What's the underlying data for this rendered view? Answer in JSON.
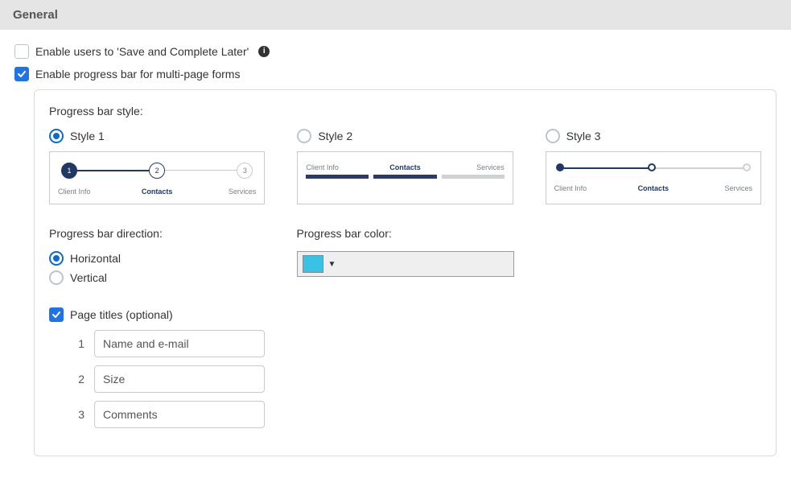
{
  "panel": {
    "title": "General"
  },
  "options": {
    "save_later": {
      "label": "Enable users to 'Save and Complete Later'",
      "checked": false,
      "info_icon": "info-icon"
    },
    "progress_bar": {
      "label": "Enable progress bar for multi-page forms",
      "checked": true
    }
  },
  "progress_settings": {
    "style_label": "Progress bar style:",
    "styles": [
      {
        "id": "style1",
        "label": "Style 1",
        "selected": true
      },
      {
        "id": "style2",
        "label": "Style 2",
        "selected": false
      },
      {
        "id": "style3",
        "label": "Style 3",
        "selected": false
      }
    ],
    "preview_steps": [
      {
        "num": "1",
        "label": "Client Info",
        "state": "done"
      },
      {
        "num": "2",
        "label": "Contacts",
        "state": "current"
      },
      {
        "num": "3",
        "label": "Services",
        "state": "future"
      }
    ],
    "direction": {
      "label": "Progress bar direction:",
      "options": [
        {
          "label": "Horizontal",
          "selected": true
        },
        {
          "label": "Vertical",
          "selected": false
        }
      ]
    },
    "color": {
      "label": "Progress bar color:",
      "value": "#39c2e6"
    },
    "page_titles": {
      "label": "Page titles (optional)",
      "checked": true,
      "items": [
        {
          "index": "1",
          "value": "Name and e-mail"
        },
        {
          "index": "2",
          "value": "Size"
        },
        {
          "index": "3",
          "value": "Comments"
        }
      ]
    }
  }
}
